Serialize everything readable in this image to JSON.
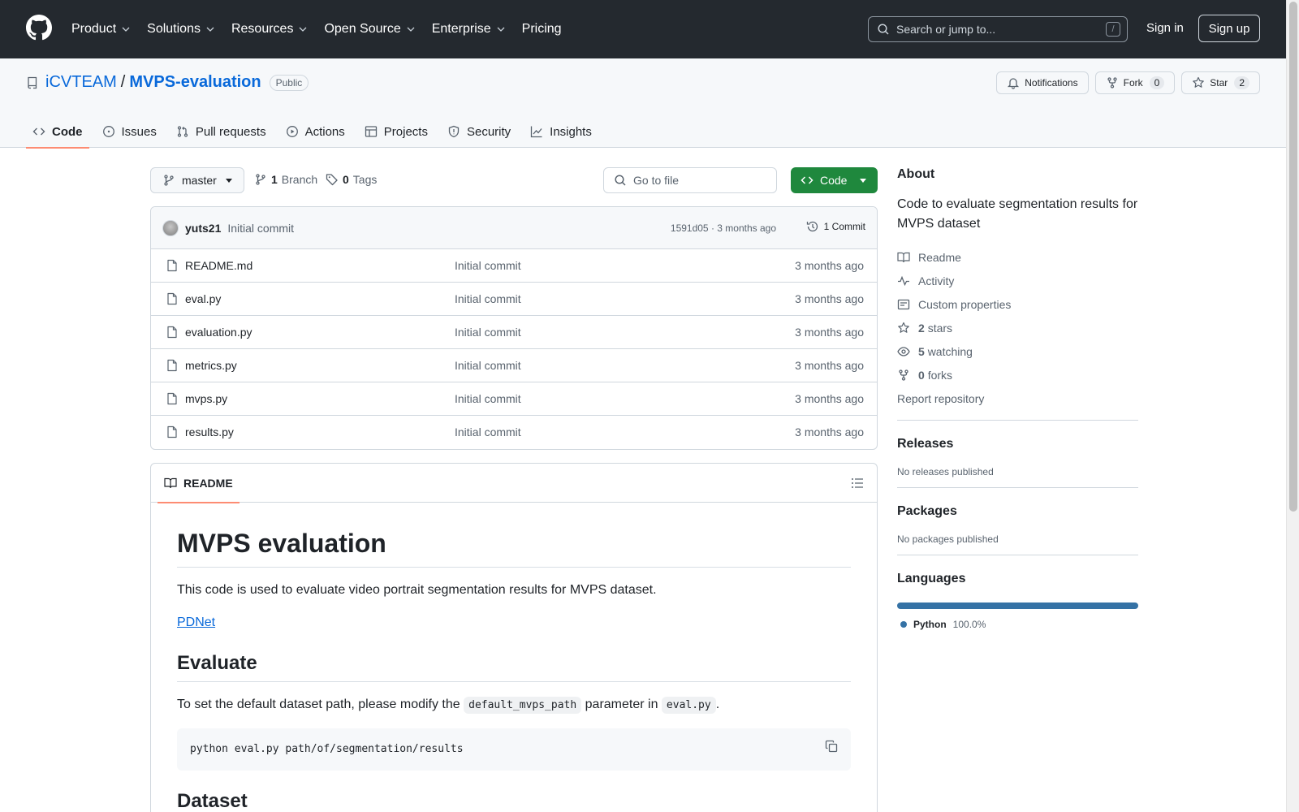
{
  "header": {
    "nav": [
      "Product",
      "Solutions",
      "Resources",
      "Open Source",
      "Enterprise",
      "Pricing"
    ],
    "search_placeholder": "Search or jump to...",
    "search_shortcut": "/",
    "sign_in": "Sign in",
    "sign_up": "Sign up"
  },
  "repo": {
    "owner": "iCVTEAM",
    "separator": "/",
    "name": "MVPS-evaluation",
    "visibility": "Public",
    "notifications_label": "Notifications",
    "fork_label": "Fork",
    "fork_count": "0",
    "star_label": "Star",
    "star_count": "2",
    "tabs": [
      "Code",
      "Issues",
      "Pull requests",
      "Actions",
      "Projects",
      "Security",
      "Insights"
    ]
  },
  "toolbar": {
    "branch": "master",
    "branch_count": "1",
    "branch_label": "Branch",
    "tag_count": "0",
    "tag_label": "Tags",
    "go_to_file": "Go to file",
    "code_label": "Code"
  },
  "commit": {
    "author": "yuts21",
    "message": "Initial commit",
    "meta": "1591d05 · 3 months ago",
    "count_label": "1 Commit"
  },
  "files": [
    {
      "name": "README.md",
      "commit": "Initial commit",
      "date": "3 months ago"
    },
    {
      "name": "eval.py",
      "commit": "Initial commit",
      "date": "3 months ago"
    },
    {
      "name": "evaluation.py",
      "commit": "Initial commit",
      "date": "3 months ago"
    },
    {
      "name": "metrics.py",
      "commit": "Initial commit",
      "date": "3 months ago"
    },
    {
      "name": "mvps.py",
      "commit": "Initial commit",
      "date": "3 months ago"
    },
    {
      "name": "results.py",
      "commit": "Initial commit",
      "date": "3 months ago"
    }
  ],
  "readme": {
    "tab_label": "README",
    "title": "MVPS evaluation",
    "intro": "This code is used to evaluate video portrait segmentation results for MVPS dataset.",
    "link": "PDNet",
    "evaluate_heading": "Evaluate",
    "evaluate_pre": "To set the default dataset path, please modify the",
    "evaluate_code1": "default_mvps_path",
    "evaluate_mid": "parameter in",
    "evaluate_code2": "eval.py",
    "evaluate_end": ".",
    "command": "python eval.py path/of/segmentation/results",
    "dataset_heading": "Dataset"
  },
  "about": {
    "heading": "About",
    "description": "Code to evaluate segmentation results for MVPS dataset",
    "readme": "Readme",
    "activity": "Activity",
    "custom_properties": "Custom properties",
    "stars_count": "2",
    "stars_label": "stars",
    "watching_count": "5",
    "watching_label": "watching",
    "forks_count": "0",
    "forks_label": "forks",
    "report": "Report repository"
  },
  "releases": {
    "heading": "Releases",
    "text": "No releases published"
  },
  "packages": {
    "heading": "Packages",
    "text": "No packages published"
  },
  "languages": {
    "heading": "Languages",
    "name": "Python",
    "percent": "100.0%",
    "color": "#3572A5"
  }
}
